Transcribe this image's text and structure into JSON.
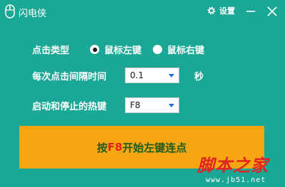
{
  "window": {
    "title": "闪电侠",
    "app_icon": "mouse-icon",
    "settings_label": "设置",
    "settings_icon": "gear-icon",
    "minimize_icon": "minimize-icon",
    "close_icon": "close-icon"
  },
  "click_type": {
    "label": "点击类型",
    "options": [
      {
        "label": "鼠标左键",
        "selected": true
      },
      {
        "label": "鼠标右键",
        "selected": false
      }
    ]
  },
  "interval": {
    "label": "每次点击间隔时间",
    "value": "0.1",
    "unit": "秒"
  },
  "hotkey": {
    "label": "启动和停止的热键",
    "value": "F8"
  },
  "start_button": {
    "prefix": "按",
    "key": "F8",
    "suffix": "开始左键连点"
  },
  "watermark": {
    "big": "脚本之家",
    "small": "www.jb51.net"
  },
  "colors": {
    "background": "#1aa796",
    "button": "#f6a612",
    "button_text": "#1d5c1d",
    "hotkey_text": "#e0201b"
  }
}
